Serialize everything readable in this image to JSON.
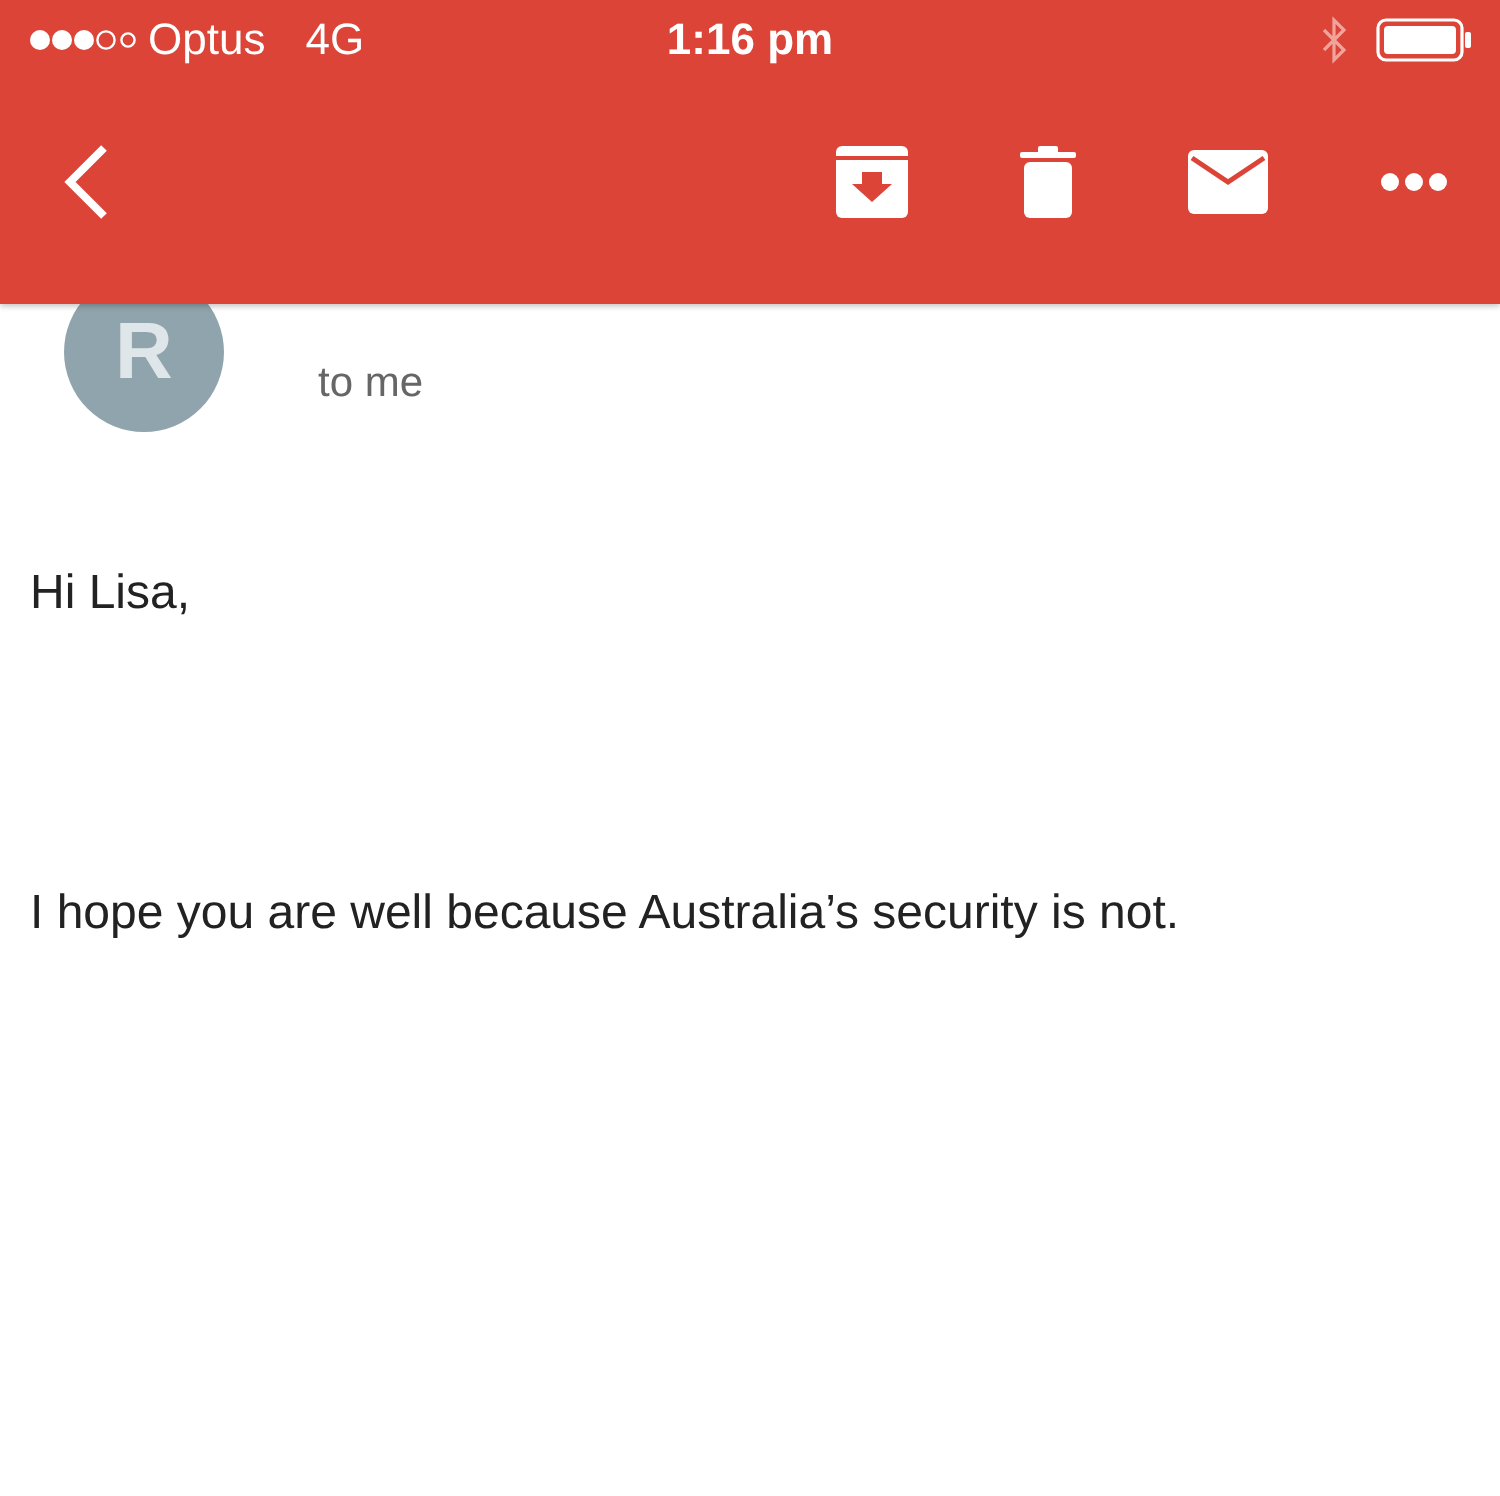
{
  "status_bar": {
    "carrier": "Optus",
    "network": "4G",
    "time": "1:16 pm"
  },
  "sender": {
    "initial": "R",
    "recipient_line": "to me"
  },
  "body": [
    "Hi Lisa,",
    "I hope you are well because Australia’s security is not."
  ]
}
